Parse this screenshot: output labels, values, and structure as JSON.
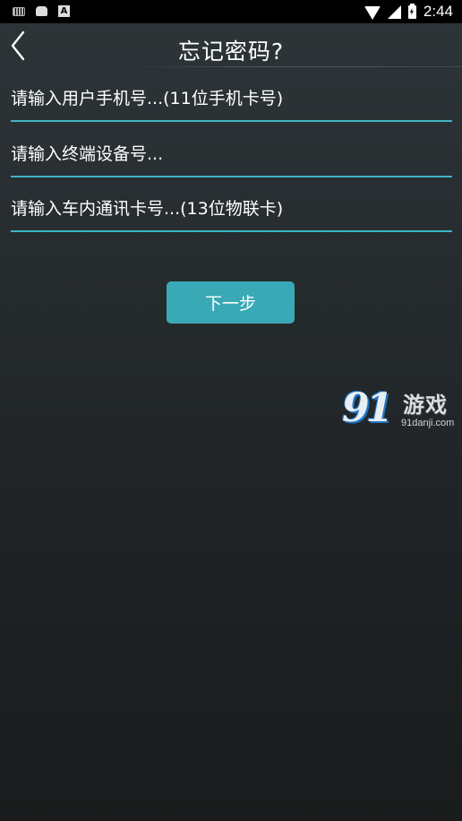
{
  "status_bar": {
    "left_icons": [
      "keyboard-icon",
      "android-icon",
      "font-a-icon"
    ],
    "a_glyph": "A",
    "time": "2:44"
  },
  "header": {
    "title": "忘记密码?"
  },
  "form": {
    "phone_placeholder": "请输入用户手机号...(11位手机卡号)",
    "terminal_placeholder": "请输入终端设备号...",
    "sim_placeholder": "请输入车内通讯卡号...(13位物联卡)",
    "next_label": "下一步"
  },
  "watermark": {
    "logo_text": "91",
    "name": "游戏",
    "url": "91danji.com"
  },
  "colors": {
    "accent": "#3aa9b6",
    "underline": "#3cb6c4",
    "bg_top": "#2e3538",
    "bg_bottom": "#191b1c"
  }
}
